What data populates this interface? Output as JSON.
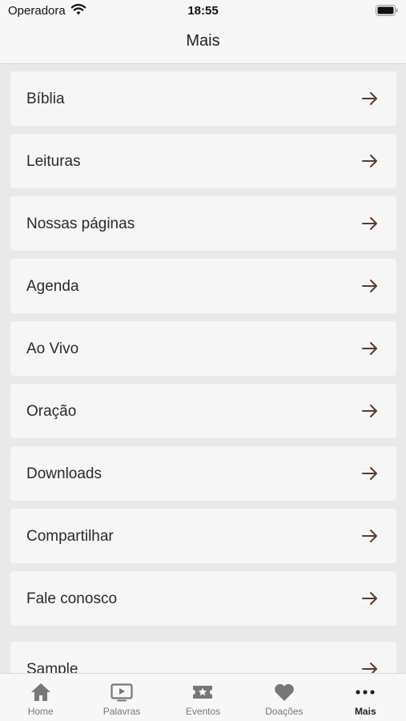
{
  "status": {
    "carrier": "Operadora",
    "time": "18:55"
  },
  "header": {
    "title": "Mais"
  },
  "menu": {
    "items": [
      {
        "label": "Bíblia"
      },
      {
        "label": "Leituras"
      },
      {
        "label": "Nossas páginas"
      },
      {
        "label": "Agenda"
      },
      {
        "label": "Ao Vivo"
      },
      {
        "label": "Oração"
      },
      {
        "label": "Downloads"
      },
      {
        "label": "Compartilhar"
      },
      {
        "label": "Fale conosco"
      },
      {
        "label": "Sample"
      }
    ]
  },
  "tabs": [
    {
      "label": "Home",
      "icon": "home-icon"
    },
    {
      "label": "Palavras",
      "icon": "play-video-icon"
    },
    {
      "label": "Eventos",
      "icon": "ticket-icon"
    },
    {
      "label": "Doações",
      "icon": "heart-icon"
    },
    {
      "label": "Mais",
      "icon": "more-dots-icon",
      "active": true
    }
  ],
  "colors": {
    "arrow": "#5a3a2e",
    "tab_inactive": "#777777",
    "tab_active": "#222222",
    "background": "#e9e9e9",
    "card": "#f6f6f6"
  }
}
